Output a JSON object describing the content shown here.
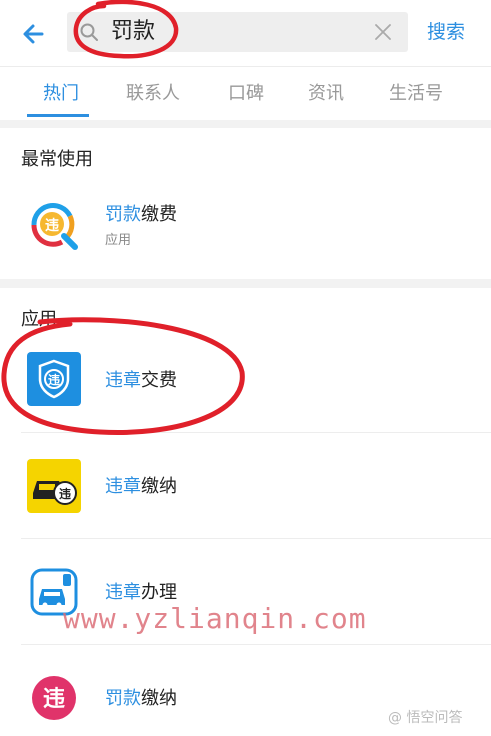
{
  "header": {
    "query": "罚款",
    "search_label": "搜索"
  },
  "tabs": [
    {
      "label": "热门",
      "active": true
    },
    {
      "label": "联系人",
      "active": false
    },
    {
      "label": "口碑",
      "active": false
    },
    {
      "label": "资讯",
      "active": false
    },
    {
      "label": "生活号",
      "active": false
    }
  ],
  "recent": {
    "title": "最常使用",
    "item": {
      "name_hl": "罚款",
      "name_rest": "缴费",
      "sub": "应用",
      "icon": "magnifier-violation-icon"
    }
  },
  "apps": {
    "title": "应用",
    "items": [
      {
        "name_hl": "违章",
        "name_rest": "交费",
        "icon": "shield-violation-icon"
      },
      {
        "name_hl": "违章",
        "name_rest": "缴纳",
        "icon": "car-violation-icon"
      },
      {
        "name_hl": "违章",
        "name_rest": "办理",
        "icon": "car-service-icon"
      },
      {
        "name_hl": "罚款",
        "name_rest": "缴纳",
        "icon": "violation-badge-icon"
      }
    ]
  },
  "overlay": {
    "watermark": "www.yzlianqin.com",
    "corner_logo": "@ 悟空问答"
  },
  "colors": {
    "accent": "#2d8fe0",
    "annotation": "#e0202a"
  }
}
